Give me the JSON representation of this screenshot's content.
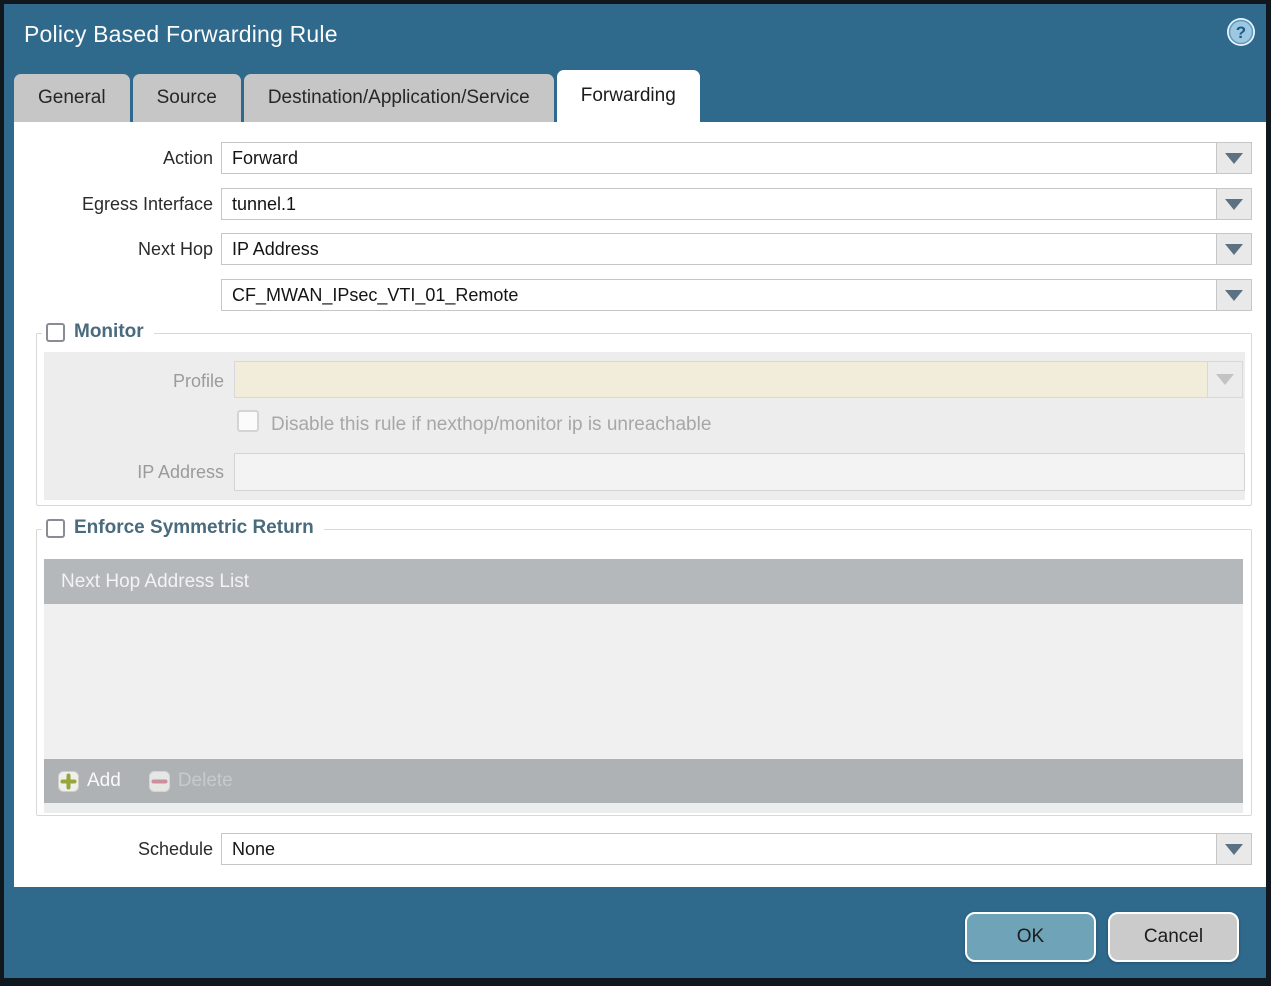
{
  "window": {
    "title": "Policy Based Forwarding Rule",
    "help_icon": "question-mark"
  },
  "tabs": [
    {
      "label": "General",
      "active": false
    },
    {
      "label": "Source",
      "active": false
    },
    {
      "label": "Destination/Application/Service",
      "active": false
    },
    {
      "label": "Forwarding",
      "active": true
    }
  ],
  "form": {
    "action_label": "Action",
    "action_value": "Forward",
    "egress_label": "Egress Interface",
    "egress_value": "tunnel.1",
    "next_hop_label": "Next Hop",
    "next_hop_value": "IP Address",
    "next_hop_address_value": "CF_MWAN_IPsec_VTI_01_Remote",
    "schedule_label": "Schedule",
    "schedule_value": "None"
  },
  "monitor": {
    "title": "Monitor",
    "checked": false,
    "profile_label": "Profile",
    "profile_value": "",
    "disable_label": "Disable this rule if nexthop/monitor ip is unreachable",
    "disable_checked": false,
    "ip_label": "IP Address",
    "ip_value": ""
  },
  "symmetric_return": {
    "title": "Enforce Symmetric Return",
    "checked": false,
    "table": {
      "header": "Next Hop Address List",
      "rows": []
    },
    "add_button": "Add",
    "delete_button": "Delete"
  },
  "footer": {
    "ok_button": "OK",
    "cancel_button": "Cancel"
  },
  "colors": {
    "dialog_teal": "#2F6A8C",
    "ok_button": "#6FA3B8",
    "cancel_button": "#CBCBCC",
    "disabled_profile_field": "#F2ECDB",
    "legend_text": "#4A6B7D",
    "table_header_bg": "#B4B8BB",
    "add_plus": "#97A53A",
    "delete_minus": "#CC8FA0"
  }
}
